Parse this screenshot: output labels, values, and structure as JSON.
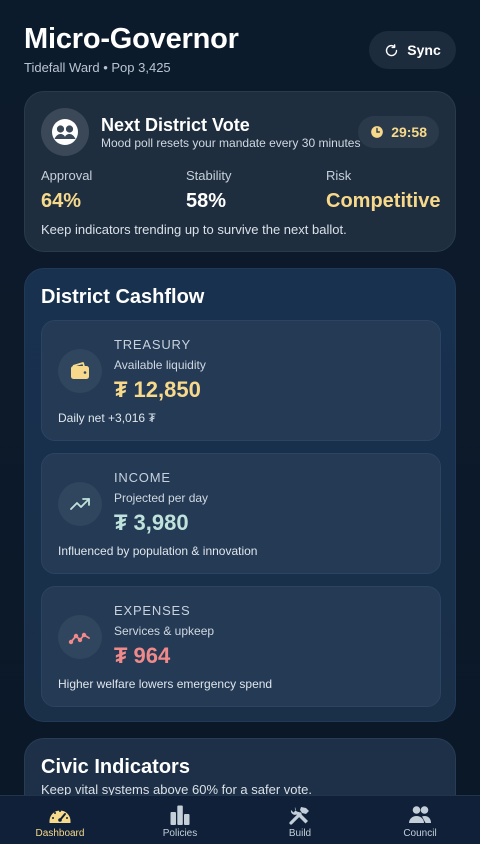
{
  "header": {
    "title": "Micro-Governor",
    "subtitle": "Tidefall Ward • Pop 3,425",
    "sync_label": "Sync"
  },
  "vote": {
    "title": "Next District Vote",
    "subtitle": "Mood poll resets your mandate every 30 minutes",
    "timer": "29:58",
    "stats": [
      {
        "label": "Approval",
        "value": "64%",
        "color": "#f7d98b"
      },
      {
        "label": "Stability",
        "value": "58%",
        "color": "#ffffff"
      },
      {
        "label": "Risk",
        "value": "Competitive",
        "color": "#f7d98b"
      }
    ],
    "note": "Keep indicators trending up to survive the next ballot."
  },
  "cashflow": {
    "title": "District Cashflow",
    "items": [
      {
        "label": "TREASURY",
        "sub": "Available liquidity",
        "value": "₮ 12,850",
        "note": "Daily net +3,016 ₮",
        "icon": "wallet-icon",
        "color": "#f7d98b"
      },
      {
        "label": "INCOME",
        "sub": "Projected per day",
        "value": "₮ 3,980",
        "note": "Influenced by population & innovation",
        "icon": "trending-up-icon",
        "color": "#bfe3dc"
      },
      {
        "label": "EXPENSES",
        "sub": "Services & upkeep",
        "value": "₮ 964",
        "note": "Higher welfare lowers emergency spend",
        "icon": "trending-down-icon",
        "color": "#f08a8a"
      }
    ]
  },
  "civic": {
    "title": "Civic Indicators",
    "subtitle": "Keep vital systems above 60% for a safer vote."
  },
  "nav": {
    "items": [
      {
        "label": "Dashboard",
        "icon": "dashboard-gauge-icon",
        "active": true
      },
      {
        "label": "Policies",
        "icon": "policies-bars-icon",
        "active": false
      },
      {
        "label": "Build",
        "icon": "build-tools-icon",
        "active": false
      },
      {
        "label": "Council",
        "icon": "council-people-icon",
        "active": false
      }
    ]
  },
  "colors": {
    "accent": "#f7d98b",
    "background": "#0b1a2b",
    "expense": "#f08a8a",
    "income": "#bfe3dc"
  }
}
